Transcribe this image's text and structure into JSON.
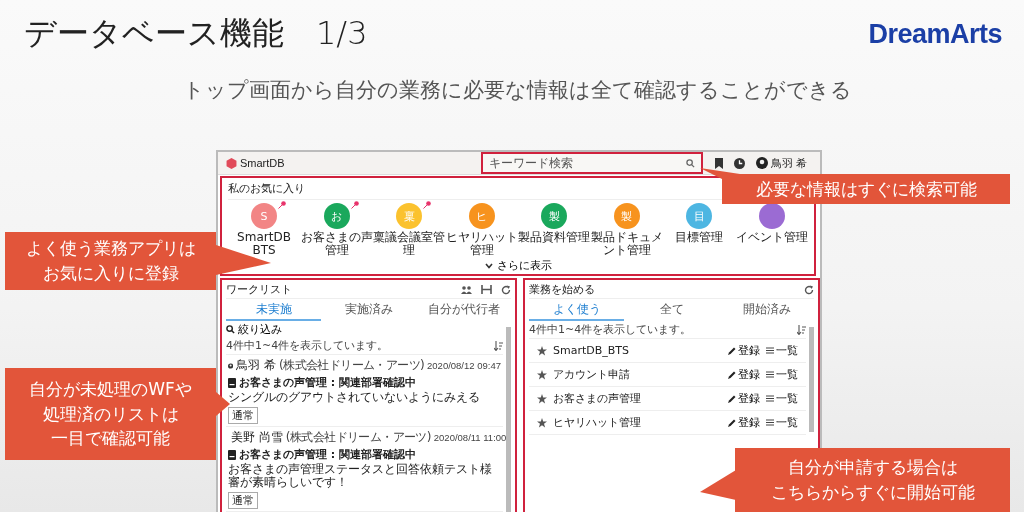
{
  "slide": {
    "title": "データベース機能　1/3",
    "logo": "DreamArts",
    "subtitle": "トップ画面から自分の業務に必要な情報は全て確認することができる"
  },
  "app": {
    "brand": "SmartDB",
    "search": {
      "placeholder": "キーワード検索"
    },
    "user": "鳥羽 希",
    "favorites": {
      "title": "私のお気に入り",
      "more": "さらに表示",
      "items": [
        {
          "letter": "S",
          "label": "SmartDB BTS",
          "color": "#f28585",
          "pinned": true
        },
        {
          "letter": "お",
          "label": "お客さまの声管理",
          "color": "#1aa85c",
          "pinned": true
        },
        {
          "letter": "稟",
          "label": "稟議会議室管理",
          "color": "#fbc22e",
          "pinned": true
        },
        {
          "letter": "ヒ",
          "label": "ヒヤリハット管理",
          "color": "#f7931e",
          "pinned": false
        },
        {
          "letter": "製",
          "label": "製品資料管理",
          "color": "#1aa85c",
          "pinned": false
        },
        {
          "letter": "製",
          "label": "製品ドキュメント管理",
          "color": "#f7931e",
          "pinned": false
        },
        {
          "letter": "目",
          "label": "目標管理",
          "color": "#4db6e2",
          "pinned": false
        },
        {
          "label": "イベント管理",
          "color": "#9b6bd3",
          "pinned": false
        }
      ]
    },
    "worklist": {
      "title": "ワークリスト",
      "tabs": [
        {
          "label": "未実施",
          "selected": true
        },
        {
          "label": "実施済み",
          "selected": false
        },
        {
          "label": "自分が代行者",
          "selected": false
        }
      ],
      "filter": "絞り込み",
      "count": "4件中1~4件を表示しています。",
      "items": [
        {
          "author": "鳥羽 希",
          "company": "(株式会社ドリーム・アーツ)",
          "date": "2020/08/12 09:47",
          "title": "お客さまの声管理 : 関連部署確認中",
          "note": "シングルのグアウトされていないようにみえる",
          "tag": "通常"
        },
        {
          "author": "美野 尚雪",
          "company": "(株式会社ドリーム・アーツ)",
          "date": "2020/08/11 11:00",
          "title": "お客さまの声管理 : 関連部署確認中",
          "note": "お客さまの声管理ステータスと回答依頼テスト様審が素晴らしいです！",
          "tag": "通常"
        }
      ]
    },
    "start": {
      "title": "業務を始める",
      "tabs": [
        {
          "label": "よく使う",
          "selected": true
        },
        {
          "label": "全て",
          "selected": false
        },
        {
          "label": "開始済み",
          "selected": false
        }
      ],
      "count": "4件中1~4件を表示しています。",
      "items": [
        {
          "name": "SmartDB_BTS",
          "register": "登録",
          "list": "一覧"
        },
        {
          "name": "アカウント申請",
          "register": "登録",
          "list": "一覧"
        },
        {
          "name": "お客さまの声管理",
          "register": "登録",
          "list": "一覧"
        },
        {
          "name": "ヒヤリハット管理",
          "register": "登録",
          "list": "一覧"
        }
      ]
    }
  },
  "callouts": [
    {
      "lines": [
        "必要な情報はすぐに検索可能"
      ]
    },
    {
      "lines": [
        "よく使う業務アプリは",
        "お気に入りに登録"
      ]
    },
    {
      "lines": [
        "自分が未処理のWFや",
        "処理済のリストは",
        "一目で確認可能"
      ]
    },
    {
      "lines": [
        "自分が申請する場合は",
        "こちらからすぐに開始可能"
      ]
    }
  ]
}
